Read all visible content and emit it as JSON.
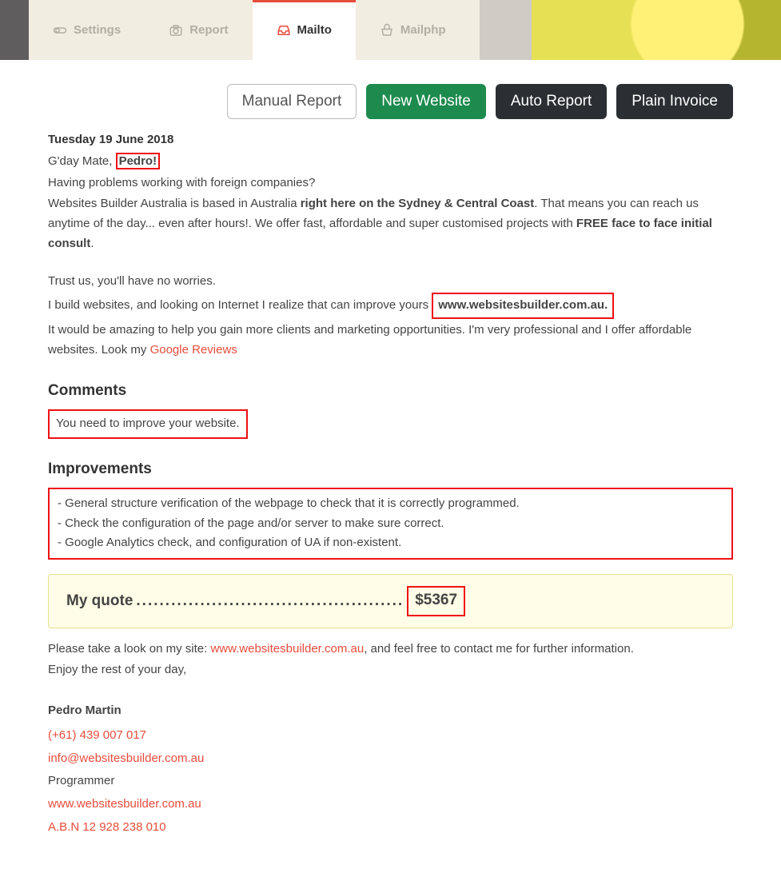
{
  "tabs": {
    "settings": "Settings",
    "report": "Report",
    "mailto": "Mailto",
    "mailphp": "Mailphp"
  },
  "actions": {
    "manual_report": "Manual Report",
    "new_website": "New Website",
    "auto_report": "Auto Report",
    "plain_invoice": "Plain Invoice"
  },
  "date": "Tuesday 19 June 2018",
  "greeting_prefix": "G'day Mate,",
  "greeting_name": "Pedro",
  "greeting_bang": "!",
  "p1": "Having problems working with foreign companies?",
  "p2a": "Websites Builder Australia is based in Australia ",
  "p2b": "right here on the Sydney & Central Coast",
  "p2c": ". That means you can reach us anytime of the day... even after hours!. We offer fast, affordable and super customised projects with ",
  "p2d": "FREE face to face initial consult",
  "p3": "Trust us, you'll have no worries.",
  "p4a": "I build websites, and looking on Internet I realize that can improve yours ",
  "p4_site": "www.websitesbuilder.com.au",
  "p5a": "It would be amazing to help you gain more clients and marketing opportunities. I'm very professional and I offer affordable websites. Look my ",
  "p5_link": "Google Reviews",
  "comments_h": "Comments",
  "comments_text": "You need to improve your website.",
  "improv_h": "Improvements",
  "improv_lines": [
    "- General structure verification of the webpage to check that it is correctly programmed.",
    "- Check the configuration of the page and/or server to make sure correct.",
    "- Google Analytics check, and configuration of UA if non-existent."
  ],
  "quote_label": "My quote",
  "quote_amount": "$5367",
  "closing_a": "Please take a look on my site: ",
  "closing_link": "www.websitesbuilder.com.au",
  "closing_b": ", and feel free to contact me for further information.",
  "closing_c": "Enjoy the rest of your day,",
  "sig": {
    "name": "Pedro Martin",
    "phone": "(+61) 439 007 017",
    "email": "info@websitesbuilder.com.au",
    "role": "Programmer",
    "site": "www.websitesbuilder.com.au",
    "abn": "A.B.N 12 928 238 010"
  }
}
